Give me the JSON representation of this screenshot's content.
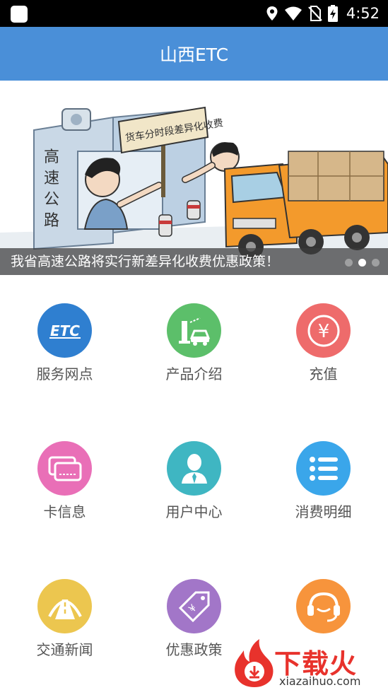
{
  "status_bar": {
    "time": "4:52",
    "icons": [
      "notification-icon",
      "location-icon",
      "wifi-icon",
      "no-sim-icon",
      "battery-charging-icon"
    ]
  },
  "app_bar": {
    "title": "山西ETC"
  },
  "banner": {
    "sign_text": "货车分时段差异化收费",
    "booth_text": "高速公路",
    "caption": "我省高速公路将实行新差异化收费优惠政策！",
    "slide_count": 3,
    "active_slide": 2
  },
  "grid": {
    "items": [
      {
        "label": "服务网点",
        "icon": "etc-logo-icon",
        "color": "#2f7fd0",
        "icon_text": "ETC"
      },
      {
        "label": "产品介绍",
        "icon": "etc-lane-car-icon",
        "color": "#5cbf6a"
      },
      {
        "label": "充值",
        "icon": "yen-coin-icon",
        "color": "#ee6b6b",
        "icon_text": "¥"
      },
      {
        "label": "卡信息",
        "icon": "cards-icon",
        "color": "#e96fb7"
      },
      {
        "label": "用户中心",
        "icon": "user-icon",
        "color": "#3fb6c2"
      },
      {
        "label": "消费明细",
        "icon": "list-icon",
        "color": "#3aa6ea"
      },
      {
        "label": "交通新闻",
        "icon": "road-icon",
        "color": "#ecc64f"
      },
      {
        "label": "优惠政策",
        "icon": "discount-tag-icon",
        "color": "#a276c8",
        "icon_text": "¥"
      },
      {
        "label": "",
        "icon": "customer-service-headset-icon",
        "color": "#f7943c"
      }
    ]
  },
  "watermark": {
    "brand": "下载火",
    "url": "xiazaihuo.com"
  }
}
